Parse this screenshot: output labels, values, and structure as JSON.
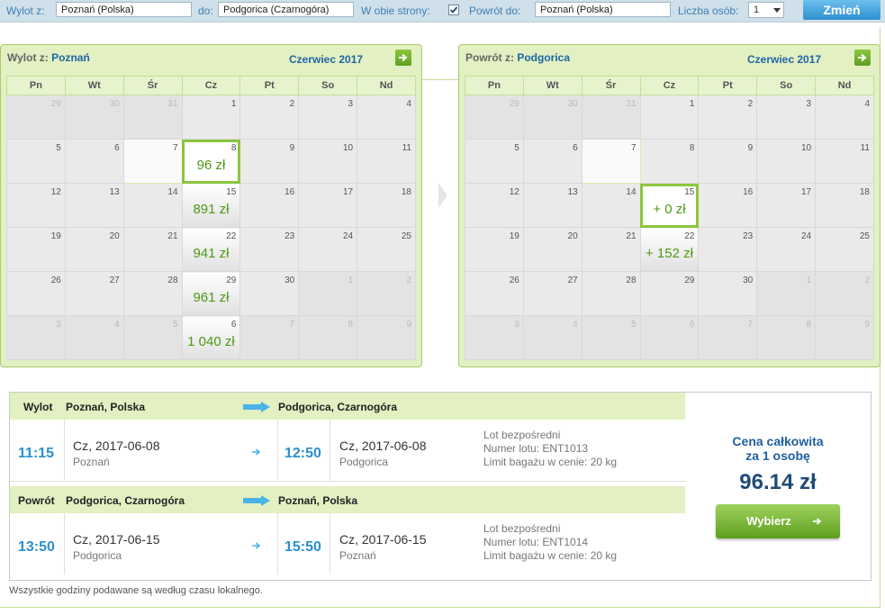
{
  "search": {
    "from_label": "Wylot z:",
    "from_value": "Poznań (Polska)",
    "to_label": "do:",
    "to_value": "Podgorica (Czarnogóra)",
    "roundtrip_label": "W obie strony:",
    "roundtrip_checked": true,
    "return_label": "Powrót do:",
    "return_value": "Poznań (Polska)",
    "persons_label": "Liczba osób:",
    "persons_value": "1",
    "change_button": "Zmień"
  },
  "weekdays": [
    "Pn",
    "Wt",
    "Śr",
    "Cz",
    "Pt",
    "So",
    "Nd"
  ],
  "outbound_calendar": {
    "title_prefix": "Wylot z:",
    "city": "Poznań",
    "month": "Czerwiec 2017",
    "weeks": [
      [
        {
          "d": "29",
          "s": "dim"
        },
        {
          "d": "30",
          "s": "dim"
        },
        {
          "d": "31",
          "s": "dim"
        },
        {
          "d": "1",
          "s": "cur"
        },
        {
          "d": "2",
          "s": "cur"
        },
        {
          "d": "3",
          "s": "cur"
        },
        {
          "d": "4",
          "s": "cur"
        }
      ],
      [
        {
          "d": "5",
          "s": "cur"
        },
        {
          "d": "6",
          "s": "cur"
        },
        {
          "d": "7",
          "s": "today"
        },
        {
          "d": "8",
          "s": "sel",
          "p": "96 zł"
        },
        {
          "d": "9",
          "s": "cur"
        },
        {
          "d": "10",
          "s": "cur"
        },
        {
          "d": "11",
          "s": "cur"
        }
      ],
      [
        {
          "d": "12",
          "s": "cur"
        },
        {
          "d": "13",
          "s": "cur"
        },
        {
          "d": "14",
          "s": "cur"
        },
        {
          "d": "15",
          "s": "price",
          "p": "891 zł"
        },
        {
          "d": "16",
          "s": "cur"
        },
        {
          "d": "17",
          "s": "cur"
        },
        {
          "d": "18",
          "s": "cur"
        }
      ],
      [
        {
          "d": "19",
          "s": "cur"
        },
        {
          "d": "20",
          "s": "cur"
        },
        {
          "d": "21",
          "s": "cur"
        },
        {
          "d": "22",
          "s": "price",
          "p": "941 zł"
        },
        {
          "d": "23",
          "s": "cur"
        },
        {
          "d": "24",
          "s": "cur"
        },
        {
          "d": "25",
          "s": "cur"
        }
      ],
      [
        {
          "d": "26",
          "s": "cur"
        },
        {
          "d": "27",
          "s": "cur"
        },
        {
          "d": "28",
          "s": "cur"
        },
        {
          "d": "29",
          "s": "price",
          "p": "961 zł"
        },
        {
          "d": "30",
          "s": "cur"
        },
        {
          "d": "1",
          "s": "dim"
        },
        {
          "d": "2",
          "s": "dim"
        }
      ],
      [
        {
          "d": "3",
          "s": "dim"
        },
        {
          "d": "4",
          "s": "dim"
        },
        {
          "d": "5",
          "s": "dim"
        },
        {
          "d": "6",
          "s": "price",
          "p": "1 040 zł"
        },
        {
          "d": "7",
          "s": "dim"
        },
        {
          "d": "8",
          "s": "dim"
        },
        {
          "d": "9",
          "s": "dim"
        }
      ]
    ]
  },
  "return_calendar": {
    "title_prefix": "Powrót z:",
    "city": "Podgorica",
    "month": "Czerwiec 2017",
    "weeks": [
      [
        {
          "d": "29",
          "s": "dim"
        },
        {
          "d": "30",
          "s": "dim"
        },
        {
          "d": "31",
          "s": "dim"
        },
        {
          "d": "1",
          "s": "cur"
        },
        {
          "d": "2",
          "s": "cur"
        },
        {
          "d": "3",
          "s": "cur"
        },
        {
          "d": "4",
          "s": "cur"
        }
      ],
      [
        {
          "d": "5",
          "s": "cur"
        },
        {
          "d": "6",
          "s": "cur"
        },
        {
          "d": "7",
          "s": "today"
        },
        {
          "d": "8",
          "s": "cur"
        },
        {
          "d": "9",
          "s": "cur"
        },
        {
          "d": "10",
          "s": "cur"
        },
        {
          "d": "11",
          "s": "cur"
        }
      ],
      [
        {
          "d": "12",
          "s": "cur"
        },
        {
          "d": "13",
          "s": "cur"
        },
        {
          "d": "14",
          "s": "cur"
        },
        {
          "d": "15",
          "s": "sel",
          "p": "+ 0 zł"
        },
        {
          "d": "16",
          "s": "cur"
        },
        {
          "d": "17",
          "s": "cur"
        },
        {
          "d": "18",
          "s": "cur"
        }
      ],
      [
        {
          "d": "19",
          "s": "cur"
        },
        {
          "d": "20",
          "s": "cur"
        },
        {
          "d": "21",
          "s": "cur"
        },
        {
          "d": "22",
          "s": "price",
          "p": "+ 152 zł"
        },
        {
          "d": "23",
          "s": "cur"
        },
        {
          "d": "24",
          "s": "cur"
        },
        {
          "d": "25",
          "s": "cur"
        }
      ],
      [
        {
          "d": "26",
          "s": "cur"
        },
        {
          "d": "27",
          "s": "cur"
        },
        {
          "d": "28",
          "s": "cur"
        },
        {
          "d": "29",
          "s": "cur"
        },
        {
          "d": "30",
          "s": "cur"
        },
        {
          "d": "1",
          "s": "dim"
        },
        {
          "d": "2",
          "s": "dim"
        }
      ],
      [
        {
          "d": "3",
          "s": "dim"
        },
        {
          "d": "4",
          "s": "dim"
        },
        {
          "d": "5",
          "s": "dim"
        },
        {
          "d": "6",
          "s": "dim"
        },
        {
          "d": "7",
          "s": "dim"
        },
        {
          "d": "8",
          "s": "dim"
        },
        {
          "d": "9",
          "s": "dim"
        }
      ]
    ]
  },
  "summary": {
    "outbound": {
      "label": "Wylot",
      "from": "Poznań, Polska",
      "to": "Podgorica, Czarnogóra",
      "dep_time": "11:15",
      "dep_date": "Cz, 2017-06-08",
      "dep_city": "Poznań",
      "arr_time": "12:50",
      "arr_date": "Cz, 2017-06-08",
      "arr_city": "Podgorica",
      "info1": "Lot bezpośredni",
      "info2": "Numer lotu: ENT1013",
      "info3": "Limit bagażu w cenie: 20 kg"
    },
    "return": {
      "label": "Powrót",
      "from": "Podgorica, Czarnogóra",
      "to": "Poznań, Polska",
      "dep_time": "13:50",
      "dep_date": "Cz, 2017-06-15",
      "dep_city": "Podgorica",
      "arr_time": "15:50",
      "arr_date": "Cz, 2017-06-15",
      "arr_city": "Poznań",
      "info1": "Lot bezpośredni",
      "info2": "Numer lotu: ENT1014",
      "info3": "Limit bagażu w cenie: 20 kg"
    },
    "total_label_1": "Cena całkowita",
    "total_label_2": "za 1 osobę",
    "total_price": "96.14 zł",
    "select_button": "Wybierz"
  },
  "footnote": "Wszystkie godziny podawane są według czasu lokalnego.",
  "colors": {
    "accent_green": "#8cc63f",
    "price_green": "#4c9a15",
    "time_blue": "#2b8fd1",
    "title_blue": "#1f66a4"
  }
}
